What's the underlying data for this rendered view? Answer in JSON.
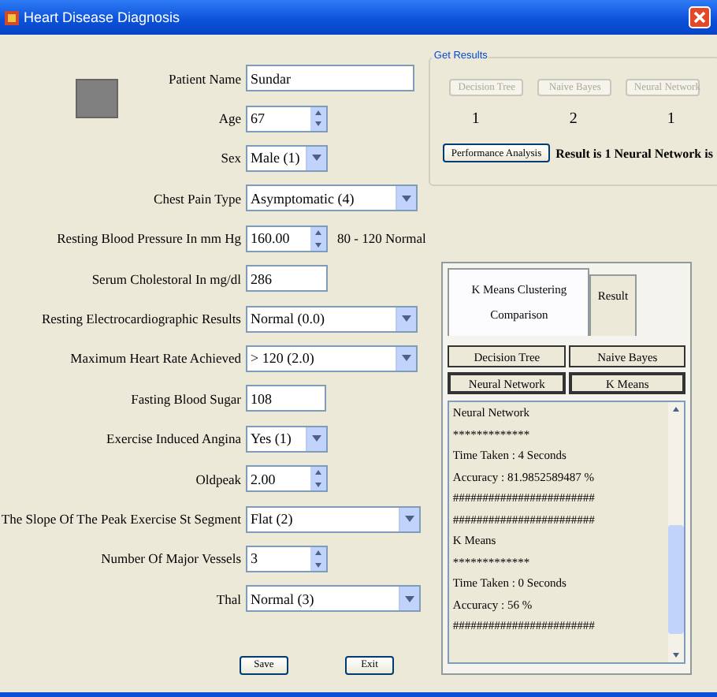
{
  "window": {
    "title": "Heart Disease Diagnosis"
  },
  "fields": [
    {
      "kind": "text",
      "label": "Patient Name",
      "value": "Sundar"
    },
    {
      "kind": "spin",
      "label": "Age",
      "value": "67"
    },
    {
      "kind": "combo",
      "label": "Sex",
      "value": "Male (1)"
    },
    {
      "kind": "combo",
      "label": "Chest Pain Type",
      "value": "Asymptomatic (4)"
    },
    {
      "kind": "spin",
      "label": "Resting Blood Pressure In mm Hg",
      "value": "160.00",
      "hint": "80 - 120 Normal"
    },
    {
      "kind": "text",
      "label": "Serum Cholestoral In mg/dl",
      "value": "286"
    },
    {
      "kind": "combo",
      "label": "Resting Electrocardiographic Results",
      "value": "Normal (0.0)"
    },
    {
      "kind": "combo",
      "label": "Maximum Heart Rate Achieved",
      "value": "> 120 (2.0)"
    },
    {
      "kind": "text",
      "label": "Fasting Blood Sugar",
      "value": "108"
    },
    {
      "kind": "combo",
      "label": "Exercise Induced Angina",
      "value": "Yes (1)"
    },
    {
      "kind": "spin",
      "label": "Oldpeak",
      "value": "2.00"
    },
    {
      "kind": "combo",
      "label": "The Slope Of The Peak Exercise St Segment",
      "value": "Flat (2)"
    },
    {
      "kind": "spin",
      "label": "Number Of Major Vessels",
      "value": "3"
    },
    {
      "kind": "combo",
      "label": "Thal",
      "value": "Normal (3)"
    }
  ],
  "buttons": [
    "Save",
    "Exit"
  ],
  "results": {
    "title": "Get Results",
    "algorithm_buttons": [
      {
        "label": "Decision Tree",
        "disabled": true
      },
      {
        "label": "Naive Bayes",
        "disabled": true
      },
      {
        "label": "Neural Network",
        "disabled": true
      }
    ],
    "predictions": [
      "1",
      "2",
      "1"
    ],
    "analysis_button": "Performance Analysis",
    "result_text": "Result is 1 Neural Network is"
  },
  "tabs": [
    {
      "label": "K Means Clustering Comparison",
      "selected": true
    },
    {
      "label": "Result",
      "selected": false
    }
  ],
  "compare_buttons": [
    "Decision Tree",
    "Naive Bayes",
    "Neural Network",
    "K Means"
  ],
  "output_lines": [
    "Neural Network",
    "*************",
    "Time Taken : 4 Seconds",
    "Accuracy : 81.9852589487 %",
    "########################",
    "########################",
    "K Means",
    "*************",
    "Time Taken : 0 Seconds",
    "Accuracy : 56 %",
    "########################"
  ]
}
